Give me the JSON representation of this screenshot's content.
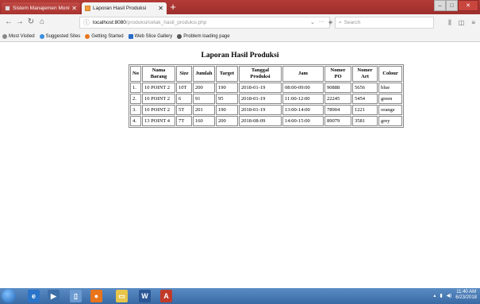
{
  "browser": {
    "tabs": [
      {
        "label": "Sistem Manajemen Monitoring",
        "active": false
      },
      {
        "label": "Laporan Hasil Produksi",
        "active": true
      }
    ],
    "url_host": "localhost:8080",
    "url_path": "/produksi/cetak_hasil_produksi.php",
    "search_placeholder": "Search",
    "bookmarks": [
      "Most Visited",
      "Suggested Sites",
      "Getting Started",
      "Web Slice Gallery",
      "Problem loading page"
    ]
  },
  "page": {
    "title": "Laporan Hasil Produksi",
    "table": {
      "columns": [
        "No",
        "Nama Barang",
        "Size",
        "Jumlah",
        "Target",
        "Tanggal Produksi",
        "Jam",
        "Nomer PO",
        "Nomer Art",
        "Colour"
      ],
      "rows": [
        [
          "1.",
          "10 POINT 2",
          "10T",
          "200",
          "190",
          "2018-01-19",
          "08:00-09:00",
          "90888",
          "5656",
          "blue"
        ],
        [
          "2.",
          "10 POINT 2",
          "6",
          "91",
          "95",
          "2018-01-19",
          "11:00-12:00",
          "22245",
          "5454",
          "green"
        ],
        [
          "3.",
          "10 POINT 2",
          "5T",
          "201",
          "190",
          "2018-01-19",
          "13:00-14:00",
          "78904",
          "1221",
          "orange"
        ],
        [
          "4.",
          "13 POINT 4",
          "7T",
          "160",
          "200",
          "2018-08-09",
          "14:00-15:00",
          "89079",
          "3581",
          "grey"
        ]
      ]
    }
  },
  "taskbar": {
    "time": "11:40 AM",
    "date": "6/23/2018"
  },
  "colors": {
    "titlebar": "#b43a36",
    "taskbar": "#4a7cb6"
  }
}
